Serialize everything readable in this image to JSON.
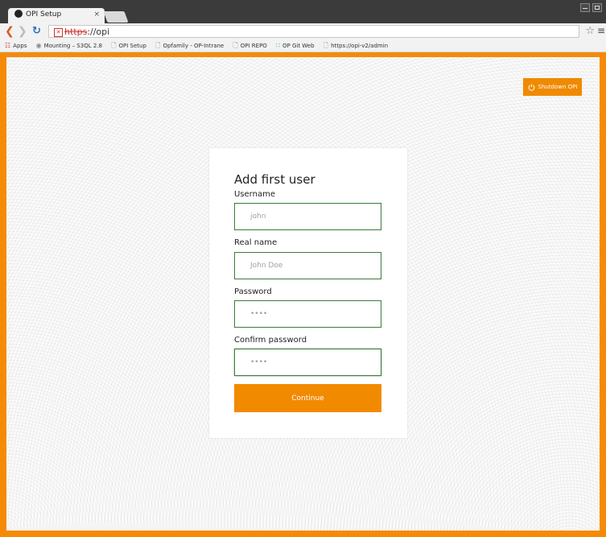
{
  "browser": {
    "tab_title": "OPI Setup",
    "tab_close": "×",
    "url_scheme": "https",
    "url_rest": "://opi",
    "bookmarks": [
      {
        "label": "Apps",
        "icon": "apps-grid-icon"
      },
      {
        "label": "Mounting – S3QL 2.8",
        "icon": "s3ql-icon"
      },
      {
        "label": "OPI Setup",
        "icon": "page-icon"
      },
      {
        "label": "Opfamily - OP-Intrane",
        "icon": "page-icon"
      },
      {
        "label": "OPI REPO",
        "icon": "page-icon"
      },
      {
        "label": "OP Git Web",
        "icon": "git-icon"
      },
      {
        "label": "https://opi-v2/admin",
        "icon": "page-icon"
      }
    ]
  },
  "page": {
    "shutdown_label": "Shutdown OPI",
    "form_title": "Add first user",
    "username_label": "Username",
    "username_placeholder": "john",
    "realname_label": "Real name",
    "realname_placeholder": "John Doe",
    "password_label": "Password",
    "password_value": "••••",
    "confirm_label": "Confirm password",
    "confirm_value": "••••",
    "continue_label": "Continue"
  },
  "colors": {
    "accent": "#f28a00",
    "input_border": "#3d7a3b"
  }
}
